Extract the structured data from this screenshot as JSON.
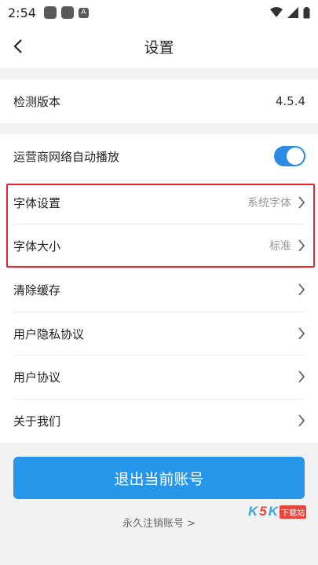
{
  "status": {
    "time": "2:54",
    "app3_letter": "A"
  },
  "header": {
    "title": "设置"
  },
  "rows": {
    "version": {
      "label": "检测版本",
      "value": "4.5.4"
    },
    "autoplay": {
      "label": "运营商网络自动播放",
      "on": true
    },
    "font_setting": {
      "label": "字体设置",
      "value": "系统字体"
    },
    "font_size": {
      "label": "字体大小",
      "value": "标准"
    },
    "clear_cache": {
      "label": "清除缓存"
    },
    "privacy": {
      "label": "用户隐私协议"
    },
    "agreement": {
      "label": "用户协议"
    },
    "about": {
      "label": "关于我们"
    }
  },
  "logout_label": "退出当前账号",
  "cancel_account_label": "永久注销账号 >",
  "watermark": {
    "k1": "K",
    "k2": "K",
    "s": "5",
    "site": "下载站"
  },
  "colors": {
    "accent": "#2596ea",
    "toggle": "#2b8be6",
    "highlight": "#e3242b"
  }
}
